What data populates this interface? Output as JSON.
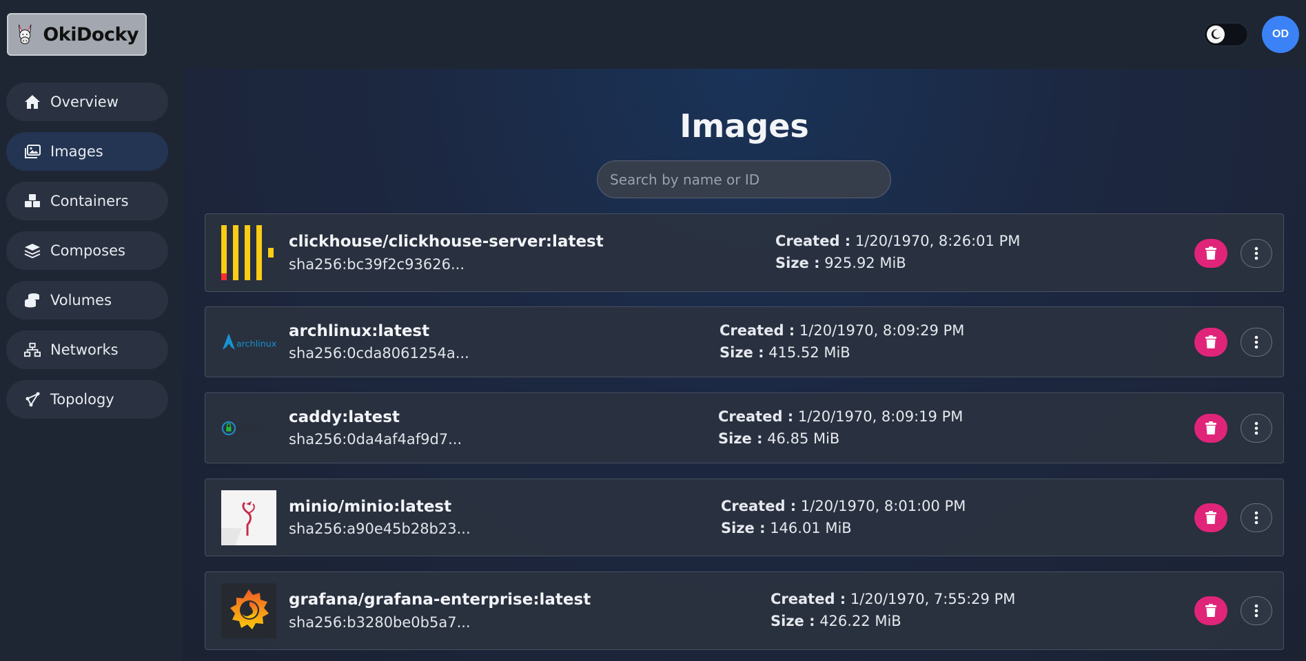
{
  "app": {
    "name": "OkiDocky"
  },
  "header": {
    "avatar_initials": "OD",
    "theme_mode": "dark"
  },
  "sidebar": {
    "items": [
      {
        "label": "Overview",
        "icon": "home-icon",
        "active": false
      },
      {
        "label": "Images",
        "icon": "images-icon",
        "active": true
      },
      {
        "label": "Containers",
        "icon": "cubes-icon",
        "active": false
      },
      {
        "label": "Composes",
        "icon": "layers-icon",
        "active": false
      },
      {
        "label": "Volumes",
        "icon": "coins-icon",
        "active": false
      },
      {
        "label": "Networks",
        "icon": "network-icon",
        "active": false
      },
      {
        "label": "Topology",
        "icon": "topology-icon",
        "active": false
      }
    ]
  },
  "main": {
    "title": "Images",
    "search": {
      "placeholder": "Search by name or ID",
      "value": ""
    },
    "created_label": "Created :",
    "size_label": "Size :",
    "images": [
      {
        "name": "clickhouse/clickhouse-server:latest",
        "hash": "sha256:bc39f2c93626...",
        "created": "1/20/1970, 8:26:01 PM",
        "size": "925.92 MiB",
        "logo": "clickhouse-logo"
      },
      {
        "name": "archlinux:latest",
        "hash": "sha256:0cda8061254a...",
        "created": "1/20/1970, 8:09:29 PM",
        "size": "415.52 MiB",
        "logo": "archlinux-logo"
      },
      {
        "name": "caddy:latest",
        "hash": "sha256:0da4af4af9d7...",
        "created": "1/20/1970, 8:09:19 PM",
        "size": "46.85 MiB",
        "logo": "caddy-logo"
      },
      {
        "name": "minio/minio:latest",
        "hash": "sha256:a90e45b28b23...",
        "created": "1/20/1970, 8:01:00 PM",
        "size": "146.01 MiB",
        "logo": "minio-logo"
      },
      {
        "name": "grafana/grafana-enterprise:latest",
        "hash": "sha256:b3280be0b5a7...",
        "created": "1/20/1970, 7:55:29 PM",
        "size": "426.22 MiB",
        "logo": "grafana-logo"
      }
    ]
  },
  "colors": {
    "accent": "#3b82f6",
    "delete": "#e0247a",
    "active_nav": "#233552"
  }
}
